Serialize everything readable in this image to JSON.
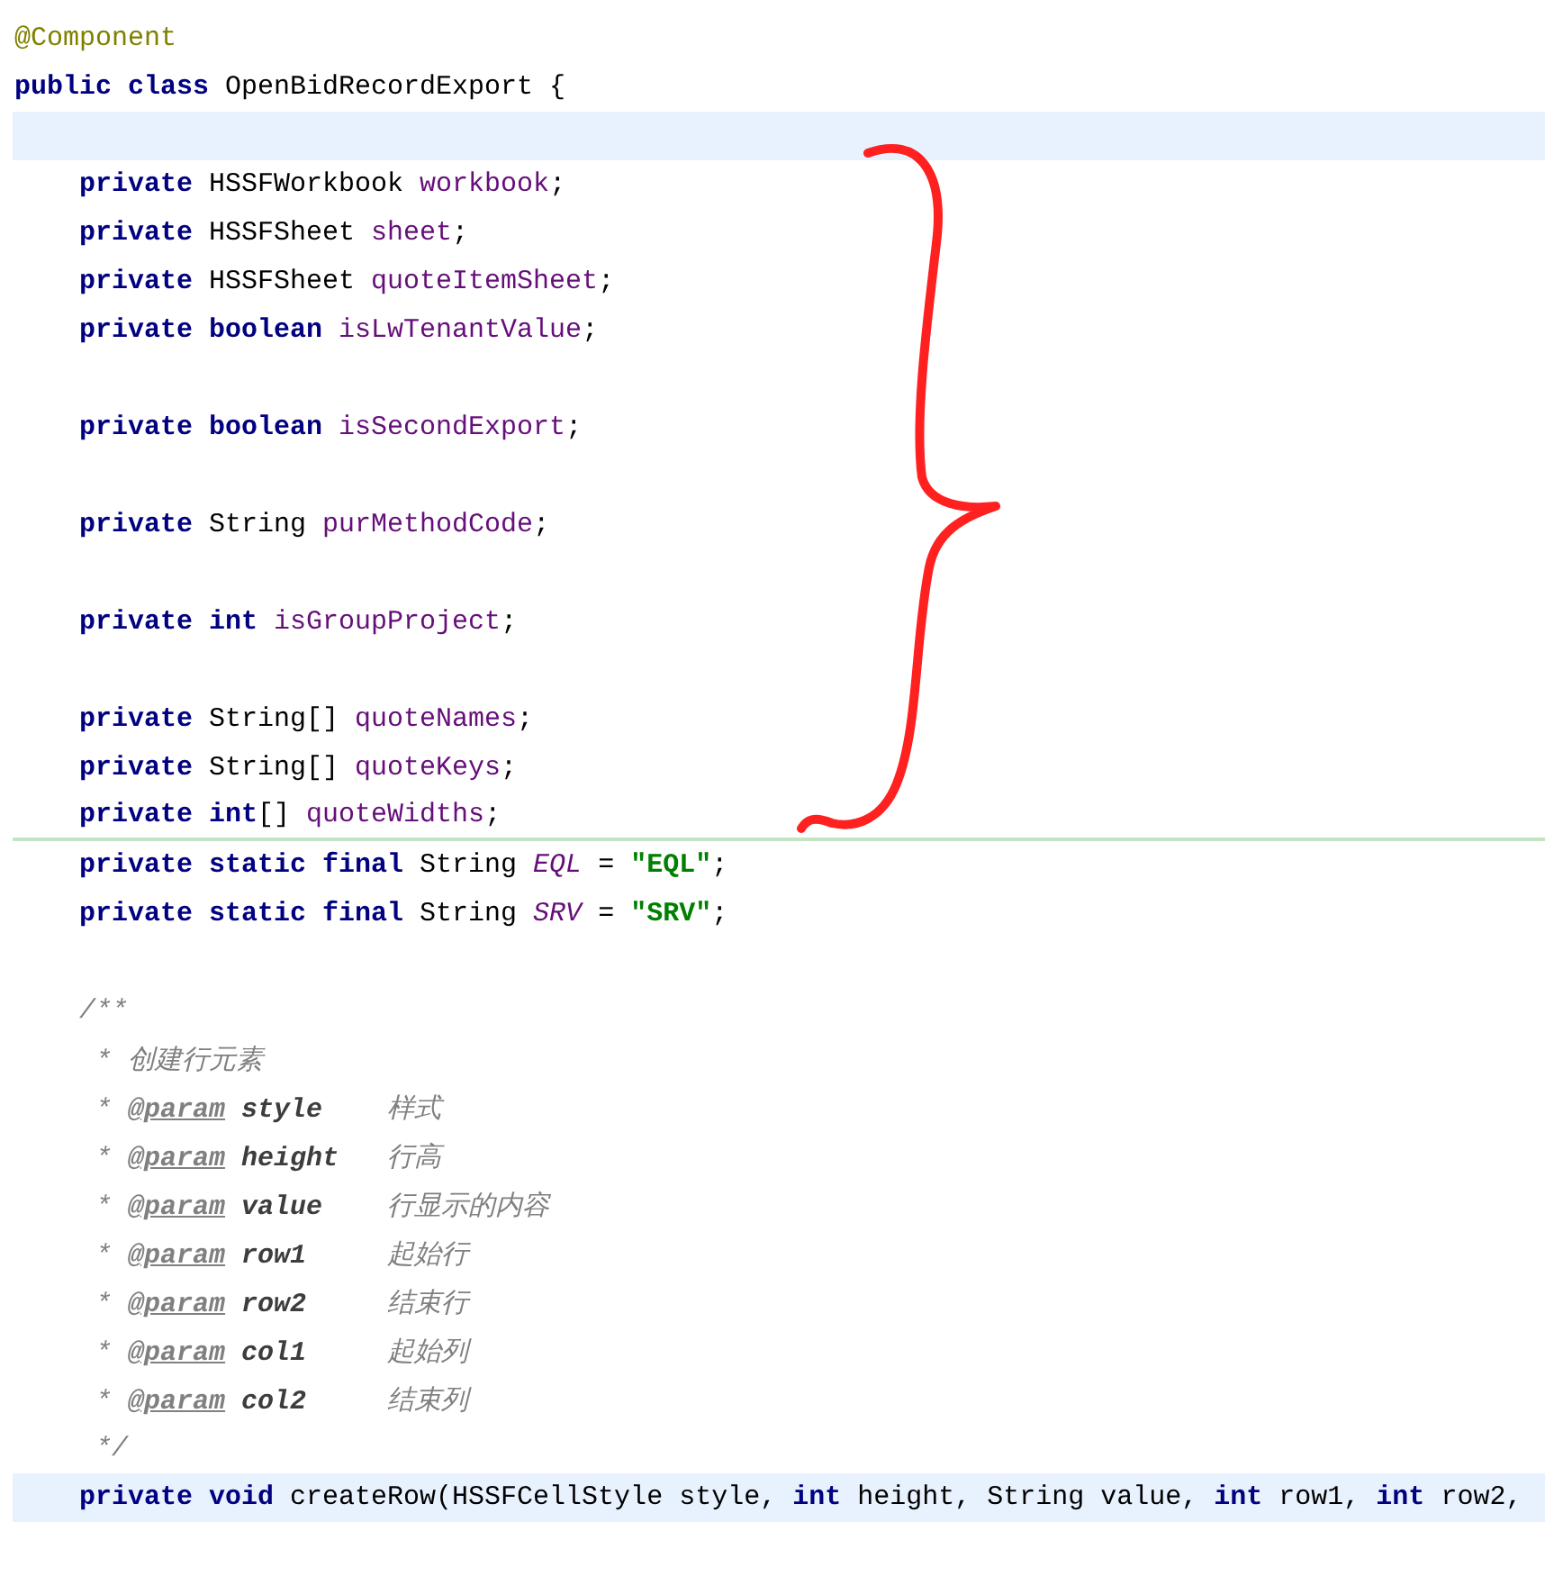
{
  "editor": {
    "lines": [
      {
        "kind": "top",
        "current": false,
        "rule_below": false,
        "tokens": [
          {
            "text": "@Component",
            "kind": "annotation"
          }
        ]
      },
      {
        "kind": "top",
        "current": false,
        "rule_below": false,
        "tokens": [
          {
            "text": "public class ",
            "kind": "keyword"
          },
          {
            "text": "OpenBidRecordExport {",
            "kind": "plain"
          }
        ]
      },
      {
        "kind": "blank",
        "current": true,
        "rule_below": false
      },
      {
        "kind": "member",
        "current": false,
        "rule_below": false,
        "tokens": [
          {
            "text": "private ",
            "kind": "keyword"
          },
          {
            "text": "HSSFWorkbook ",
            "kind": "plain"
          },
          {
            "text": "workbook",
            "kind": "field"
          },
          {
            "text": ";",
            "kind": "plain"
          }
        ]
      },
      {
        "kind": "member",
        "current": false,
        "rule_below": false,
        "tokens": [
          {
            "text": "private ",
            "kind": "keyword"
          },
          {
            "text": "HSSFSheet ",
            "kind": "plain"
          },
          {
            "text": "sheet",
            "kind": "field"
          },
          {
            "text": ";",
            "kind": "plain"
          }
        ]
      },
      {
        "kind": "member",
        "current": false,
        "rule_below": false,
        "tokens": [
          {
            "text": "private ",
            "kind": "keyword"
          },
          {
            "text": "HSSFSheet ",
            "kind": "plain"
          },
          {
            "text": "quoteItemSheet",
            "kind": "field"
          },
          {
            "text": ";",
            "kind": "plain"
          }
        ]
      },
      {
        "kind": "member",
        "current": false,
        "rule_below": false,
        "tokens": [
          {
            "text": "private boolean ",
            "kind": "keyword"
          },
          {
            "text": "isLwTenantValue",
            "kind": "field"
          },
          {
            "text": ";",
            "kind": "plain"
          }
        ]
      },
      {
        "kind": "blank",
        "current": false,
        "rule_below": false
      },
      {
        "kind": "member",
        "current": false,
        "rule_below": false,
        "tokens": [
          {
            "text": "private boolean ",
            "kind": "keyword"
          },
          {
            "text": "isSecondExport",
            "kind": "field"
          },
          {
            "text": ";",
            "kind": "plain"
          }
        ]
      },
      {
        "kind": "blank",
        "current": false,
        "rule_below": false
      },
      {
        "kind": "member",
        "current": false,
        "rule_below": false,
        "tokens": [
          {
            "text": "private ",
            "kind": "keyword"
          },
          {
            "text": "String ",
            "kind": "plain"
          },
          {
            "text": "purMethodCode",
            "kind": "field"
          },
          {
            "text": ";",
            "kind": "plain"
          }
        ]
      },
      {
        "kind": "blank",
        "current": false,
        "rule_below": false
      },
      {
        "kind": "member",
        "current": false,
        "rule_below": false,
        "tokens": [
          {
            "text": "private int ",
            "kind": "keyword"
          },
          {
            "text": "isGroupProject",
            "kind": "field"
          },
          {
            "text": ";",
            "kind": "plain"
          }
        ]
      },
      {
        "kind": "blank",
        "current": false,
        "rule_below": false
      },
      {
        "kind": "member",
        "current": false,
        "rule_below": false,
        "tokens": [
          {
            "text": "private ",
            "kind": "keyword"
          },
          {
            "text": "String[] ",
            "kind": "plain"
          },
          {
            "text": "quoteNames",
            "kind": "field"
          },
          {
            "text": ";",
            "kind": "plain"
          }
        ]
      },
      {
        "kind": "member",
        "current": false,
        "rule_below": false,
        "tokens": [
          {
            "text": "private ",
            "kind": "keyword"
          },
          {
            "text": "String[] ",
            "kind": "plain"
          },
          {
            "text": "quoteKeys",
            "kind": "field"
          },
          {
            "text": ";",
            "kind": "plain"
          }
        ]
      },
      {
        "kind": "member",
        "current": false,
        "rule_below": true,
        "tokens": [
          {
            "text": "private int",
            "kind": "keyword"
          },
          {
            "text": "[] ",
            "kind": "plain"
          },
          {
            "text": "quoteWidths",
            "kind": "field"
          },
          {
            "text": ";",
            "kind": "plain"
          }
        ]
      },
      {
        "kind": "member",
        "current": false,
        "rule_below": false,
        "tokens": [
          {
            "text": "private static final ",
            "kind": "keyword"
          },
          {
            "text": "String ",
            "kind": "plain"
          },
          {
            "text": "EQL",
            "kind": "static_field"
          },
          {
            "text": " = ",
            "kind": "plain"
          },
          {
            "text": "\"EQL\"",
            "kind": "string"
          },
          {
            "text": ";",
            "kind": "plain"
          }
        ]
      },
      {
        "kind": "member",
        "current": false,
        "rule_below": false,
        "tokens": [
          {
            "text": "private static final ",
            "kind": "keyword"
          },
          {
            "text": "String ",
            "kind": "plain"
          },
          {
            "text": "SRV",
            "kind": "static_field"
          },
          {
            "text": " = ",
            "kind": "plain"
          },
          {
            "text": "\"SRV\"",
            "kind": "string"
          },
          {
            "text": ";",
            "kind": "plain"
          }
        ]
      },
      {
        "kind": "blank",
        "current": false,
        "rule_below": false
      },
      {
        "kind": "member",
        "current": false,
        "rule_below": false,
        "tokens": [
          {
            "text": "/**",
            "kind": "comment"
          }
        ]
      },
      {
        "kind": "member",
        "current": false,
        "rule_below": false,
        "tokens": [
          {
            "text": " * 创建行元素",
            "kind": "comment"
          }
        ]
      },
      {
        "kind": "member",
        "current": false,
        "rule_below": false,
        "tokens": [
          {
            "text": " * ",
            "kind": "comment"
          },
          {
            "text": "@param",
            "kind": "doc_tag"
          },
          {
            "text": "style",
            "kind": "doc_param"
          },
          {
            "text": "样式",
            "kind": "comment"
          }
        ]
      },
      {
        "kind": "member",
        "current": false,
        "rule_below": false,
        "tokens": [
          {
            "text": " * ",
            "kind": "comment"
          },
          {
            "text": "@param",
            "kind": "doc_tag"
          },
          {
            "text": "height",
            "kind": "doc_param"
          },
          {
            "text": "行高",
            "kind": "comment"
          }
        ]
      },
      {
        "kind": "member",
        "current": false,
        "rule_below": false,
        "tokens": [
          {
            "text": " * ",
            "kind": "comment"
          },
          {
            "text": "@param",
            "kind": "doc_tag"
          },
          {
            "text": "value",
            "kind": "doc_param"
          },
          {
            "text": "行显示的内容",
            "kind": "comment"
          }
        ]
      },
      {
        "kind": "member",
        "current": false,
        "rule_below": false,
        "tokens": [
          {
            "text": " * ",
            "kind": "comment"
          },
          {
            "text": "@param",
            "kind": "doc_tag"
          },
          {
            "text": "row1",
            "kind": "doc_param"
          },
          {
            "text": "起始行",
            "kind": "comment"
          }
        ]
      },
      {
        "kind": "member",
        "current": false,
        "rule_below": false,
        "tokens": [
          {
            "text": " * ",
            "kind": "comment"
          },
          {
            "text": "@param",
            "kind": "doc_tag"
          },
          {
            "text": "row2",
            "kind": "doc_param"
          },
          {
            "text": "结束行",
            "kind": "comment"
          }
        ]
      },
      {
        "kind": "member",
        "current": false,
        "rule_below": false,
        "tokens": [
          {
            "text": " * ",
            "kind": "comment"
          },
          {
            "text": "@param",
            "kind": "doc_tag"
          },
          {
            "text": "col1",
            "kind": "doc_param"
          },
          {
            "text": "起始列",
            "kind": "comment"
          }
        ]
      },
      {
        "kind": "member",
        "current": false,
        "rule_below": false,
        "tokens": [
          {
            "text": " * ",
            "kind": "comment"
          },
          {
            "text": "@param",
            "kind": "doc_tag"
          },
          {
            "text": "col2",
            "kind": "doc_param"
          },
          {
            "text": "结束列",
            "kind": "comment"
          }
        ]
      },
      {
        "kind": "member",
        "current": false,
        "rule_below": false,
        "tokens": [
          {
            "text": " */",
            "kind": "comment"
          }
        ]
      },
      {
        "kind": "member",
        "current": true,
        "rule_below": false,
        "tokens": [
          {
            "text": "private void ",
            "kind": "keyword"
          },
          {
            "text": "createRow(HSSFCellStyle style, ",
            "kind": "plain"
          },
          {
            "text": "int ",
            "kind": "keyword"
          },
          {
            "text": "height, String value, ",
            "kind": "plain"
          },
          {
            "text": "int ",
            "kind": "keyword"
          },
          {
            "text": "row1, ",
            "kind": "plain"
          },
          {
            "text": "int ",
            "kind": "keyword"
          },
          {
            "text": "row2,",
            "kind": "plain"
          }
        ]
      }
    ]
  }
}
